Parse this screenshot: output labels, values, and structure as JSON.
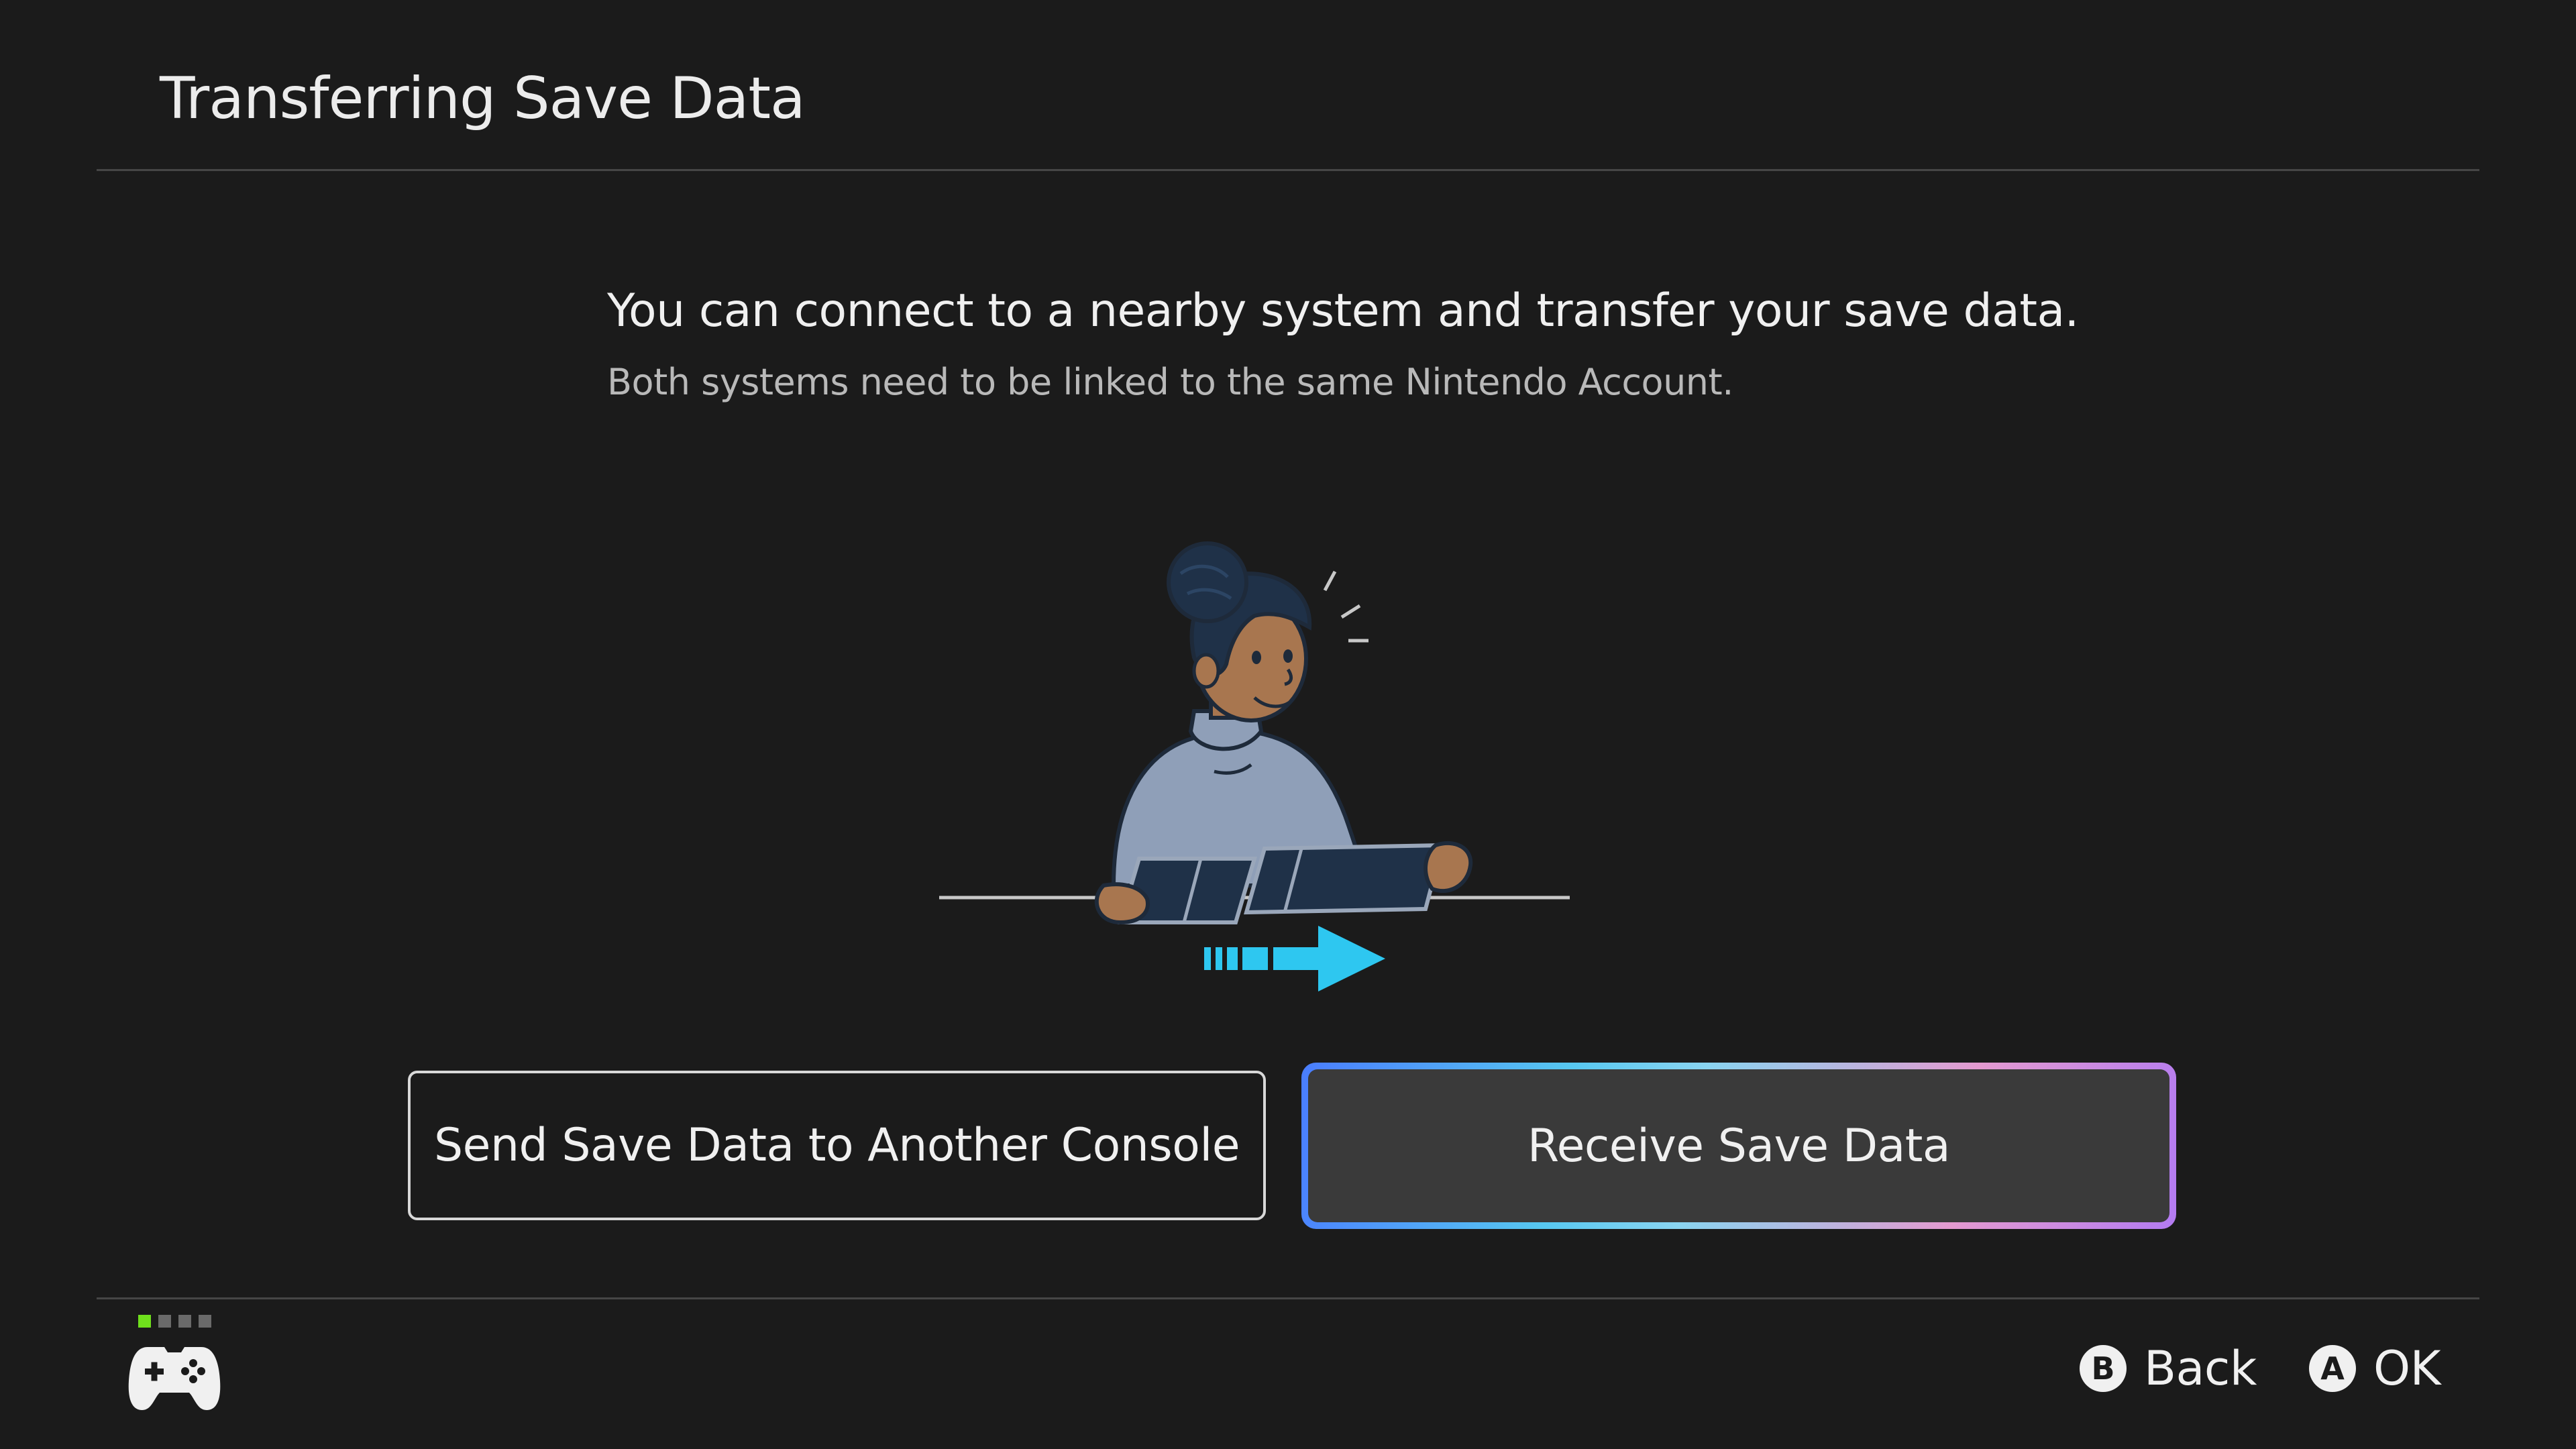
{
  "header": {
    "title": "Transferring Save Data"
  },
  "main": {
    "headline": "You can connect to a nearby system and transfer your save data.",
    "subtext": "Both systems need to be linked to the same Nintendo Account."
  },
  "illustration": {
    "icon": "person-holding-console-illustration",
    "arrow_color": "#2ec7f0"
  },
  "actions": {
    "send_label": "Send Save Data to Another Console",
    "receive_label": "Receive Save Data",
    "selected": "receive"
  },
  "footer": {
    "player_indicator": {
      "active_player": 1,
      "total": 4,
      "active_color": "#6fe01c"
    },
    "controller_icon": "gamepad-icon",
    "hints": [
      {
        "button": "B",
        "label": "Back"
      },
      {
        "button": "A",
        "label": "OK"
      }
    ]
  },
  "colors": {
    "background": "#1b1b1b",
    "text": "#ececec",
    "divider": "#464646",
    "selected_gradient": [
      "#4a7dff",
      "#57c8f0",
      "#e49ad0",
      "#b37bf2"
    ]
  }
}
